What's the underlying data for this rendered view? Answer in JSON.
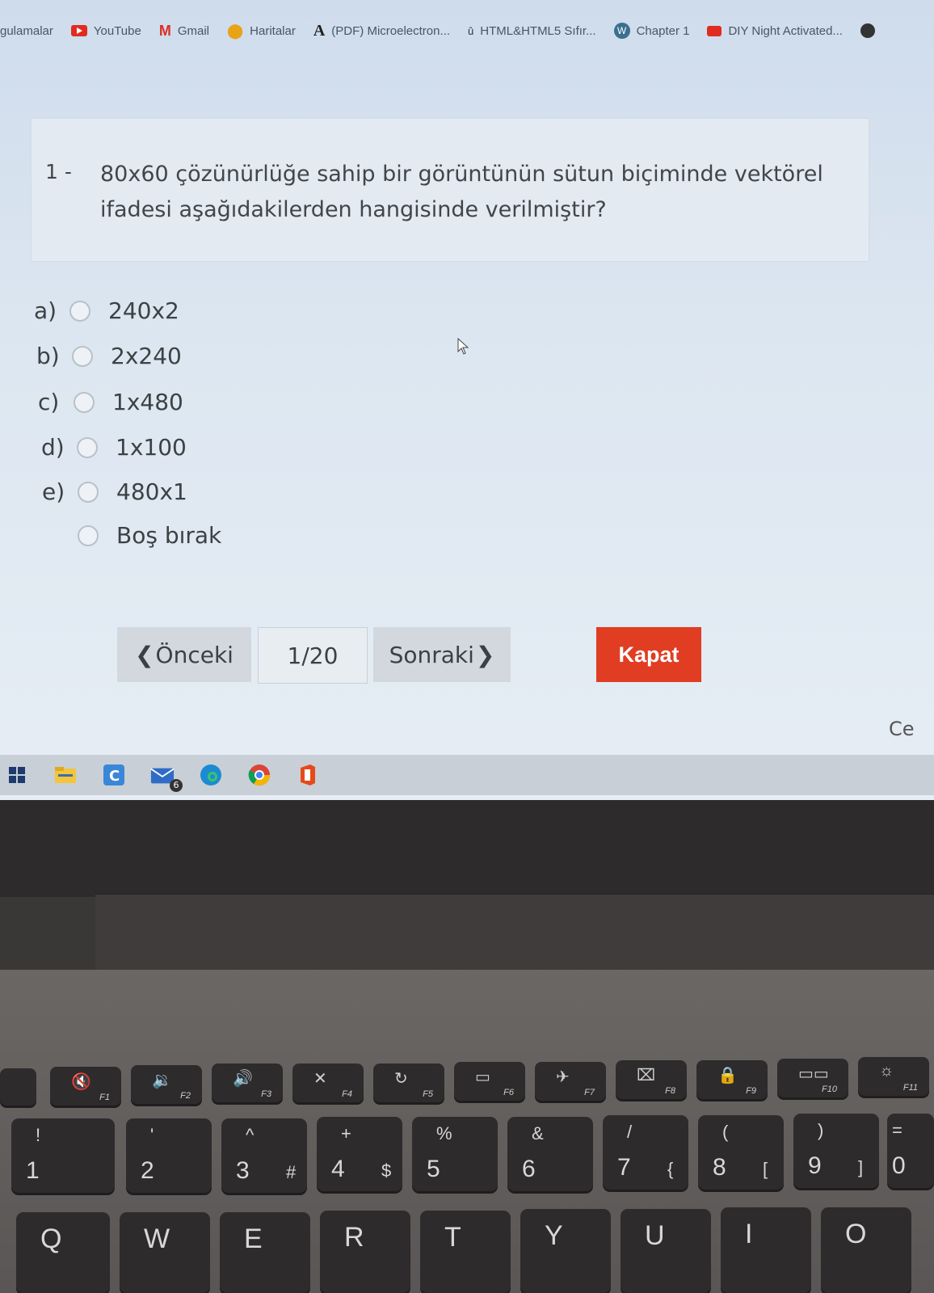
{
  "bookmarks": [
    {
      "label": "gulamalar",
      "icon": "apps-icon"
    },
    {
      "label": "YouTube",
      "icon": "youtube-icon"
    },
    {
      "label": "Gmail",
      "icon": "gmail-icon"
    },
    {
      "label": "Haritalar",
      "icon": "maps-pin-icon"
    },
    {
      "label": "(PDF) Microelectron...",
      "icon": "academia-icon"
    },
    {
      "label": "HTML&HTML5 Sıfır...",
      "icon": "udemy-icon"
    },
    {
      "label": "Chapter 1",
      "icon": "wordpress-icon"
    },
    {
      "label": "DIY Night Activated...",
      "icon": "youtube-icon"
    }
  ],
  "question": {
    "number": "1 -",
    "text": "80x60 çözünürlüğe sahip bir görüntünün sütun biçiminde vektörel ifadesi aşağıdakilerden hangisinde verilmiştir?"
  },
  "options": [
    {
      "letter": "a)",
      "text": "240x2"
    },
    {
      "letter": "b)",
      "text": "2x240"
    },
    {
      "letter": "c)",
      "text": "1x480"
    },
    {
      "letter": "d)",
      "text": "1x100"
    },
    {
      "letter": "e)",
      "text": "480x1"
    },
    {
      "letter": "",
      "text": "Boş bırak"
    }
  ],
  "nav": {
    "prev_label": "Önceki",
    "page_indicator": "1/20",
    "next_label": "Sonraki",
    "close_label": "Kapat",
    "cut_text": "Ce"
  },
  "taskbar": {
    "mail_badge": "6",
    "icons": [
      "windows-start-icon",
      "file-explorer-icon",
      "c-app-icon",
      "mail-icon",
      "edge-icon",
      "chrome-icon",
      "office-icon"
    ]
  },
  "keyboard": {
    "fn_row": [
      {
        "label": "F1",
        "sym": "🔇"
      },
      {
        "label": "F2",
        "sym": "🔉"
      },
      {
        "label": "F3",
        "sym": "🔊"
      },
      {
        "label": "F4",
        "sym": "✕"
      },
      {
        "label": "F5",
        "sym": "↻"
      },
      {
        "label": "F6",
        "sym": "▭"
      },
      {
        "label": "F7",
        "sym": "✈"
      },
      {
        "label": "F8",
        "sym": "⌧"
      },
      {
        "label": "F9",
        "sym": "🔒"
      },
      {
        "label": "F10",
        "sym": "▭▭"
      },
      {
        "label": "F11",
        "sym": "☼"
      }
    ],
    "num_row": [
      {
        "main": "1",
        "top": "!",
        "side": ""
      },
      {
        "main": "2",
        "top": "'",
        "side": ""
      },
      {
        "main": "3",
        "top": "^",
        "side": "#"
      },
      {
        "main": "4",
        "top": "+",
        "side": "$"
      },
      {
        "main": "5",
        "top": "%",
        "side": ""
      },
      {
        "main": "6",
        "top": "&",
        "side": ""
      },
      {
        "main": "7",
        "top": "/",
        "side": "{"
      },
      {
        "main": "8",
        "top": "(",
        "side": "["
      },
      {
        "main": "9",
        "top": ")",
        "side": "]"
      },
      {
        "main": "0",
        "top": "=",
        "side": ""
      }
    ],
    "letter_row": [
      "Q",
      "W",
      "E",
      "R",
      "T",
      "Y",
      "U",
      "I",
      "O"
    ]
  },
  "colors": {
    "accent_close": "#e03d22",
    "button_gray": "#d2d8de"
  }
}
